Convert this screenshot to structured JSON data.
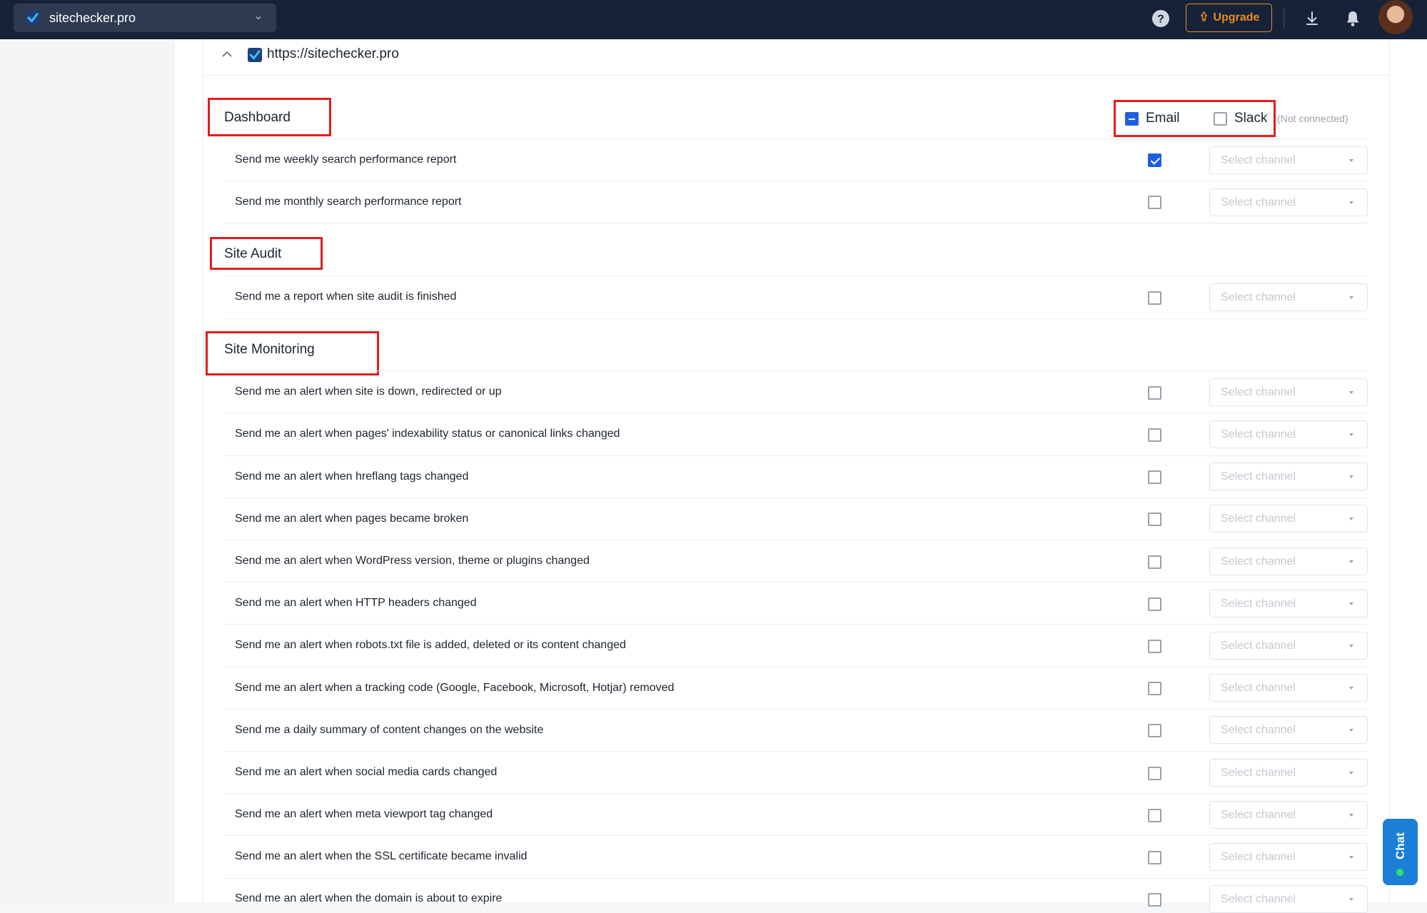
{
  "topbar": {
    "project_name": "sitechecker.pro",
    "upgrade_label": "Upgrade",
    "icons": [
      "help-icon",
      "download-icon",
      "bell-icon",
      "avatar"
    ]
  },
  "site": {
    "url": "https://sitechecker.pro"
  },
  "channels": {
    "email_label": "Email",
    "slack_label": "Slack",
    "slack_status": "(Not connected)"
  },
  "select_placeholder": "Select channel",
  "sections": [
    {
      "title": "Dashboard",
      "rows": [
        {
          "label": "Send me weekly search performance report",
          "email_checked": true
        },
        {
          "label": "Send me monthly search performance report",
          "email_checked": false
        }
      ]
    },
    {
      "title": "Site Audit",
      "rows": [
        {
          "label": "Send me a report when site audit is finished",
          "email_checked": false
        }
      ]
    },
    {
      "title": "Site Monitoring",
      "rows": [
        {
          "label": "Send me an alert when site is down, redirected or up",
          "email_checked": false
        },
        {
          "label": "Send me an alert when pages' indexability status or canonical links changed",
          "email_checked": false
        },
        {
          "label": "Send me an alert when hreflang tags changed",
          "email_checked": false
        },
        {
          "label": "Send me an alert when pages became broken",
          "email_checked": false
        },
        {
          "label": "Send me an alert when WordPress version, theme or plugins changed",
          "email_checked": false
        },
        {
          "label": "Send me an alert when HTTP headers changed",
          "email_checked": false
        },
        {
          "label": "Send me an alert when robots.txt file is added, deleted or its content changed",
          "email_checked": false
        },
        {
          "label": "Send me an alert when a tracking code (Google, Facebook, Microsoft, Hotjar) removed",
          "email_checked": false
        },
        {
          "label": "Send me a daily summary of content changes on the website",
          "email_checked": false
        },
        {
          "label": "Send me an alert when social media cards changed",
          "email_checked": false
        },
        {
          "label": "Send me an alert when meta viewport tag changed",
          "email_checked": false
        },
        {
          "label": "Send me an alert when the SSL certificate became invalid",
          "email_checked": false
        },
        {
          "label": "Send me an alert when the domain is about to expire",
          "email_checked": false
        }
      ]
    }
  ],
  "chat": {
    "label": "Chat"
  },
  "colors": {
    "topbar": "#152238",
    "accent": "#1d5fe0",
    "upgrade": "#f08a1e",
    "highlight_box": "#e21d1d",
    "chat": "#1b7fd6"
  }
}
